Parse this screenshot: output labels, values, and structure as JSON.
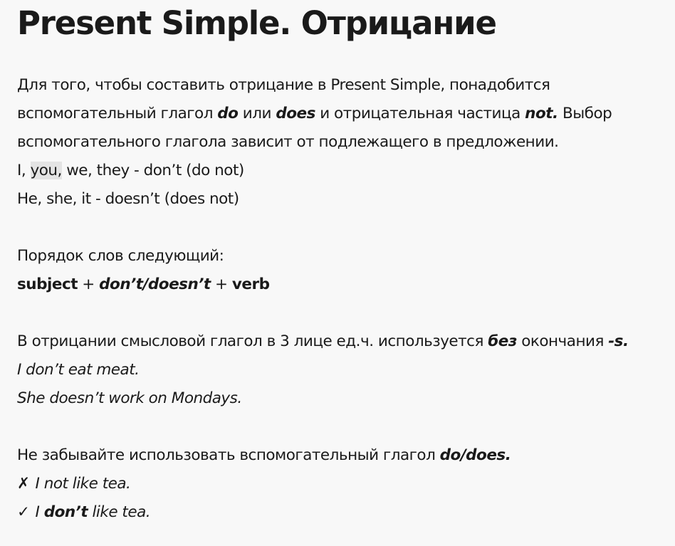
{
  "title": "Present Simple. Отрицание",
  "intro": {
    "l1": "Для того, чтобы составить отрицание в Present Simple, понадобится",
    "l2_a": "вспомогательный глагол ",
    "l2_do": "do",
    "l2_b": " или ",
    "l2_does": "does",
    "l2_c": " и отрицательная частица ",
    "l2_not": "not.",
    "l2_d": " Выбор",
    "l3": "вспомогательного глагола зависит от подлежащего в предложении."
  },
  "pronouns": {
    "p1_a": "I, ",
    "p1_you": "you,",
    "p1_b": " we, they - don’t (do not)",
    "p2": "He, she, it - doesn’t (does not)"
  },
  "order": {
    "heading": "Порядок слов следующий:",
    "subject": "subject",
    "plus1": " + ",
    "aux": "don’t/doesn’t",
    "plus2": " + ",
    "verb": "verb"
  },
  "third_person": {
    "a": "В отрицании смысловой глагол в 3 лице ед.ч. используется ",
    "bez": "без",
    "b": " окончания ",
    "s": "-s.",
    "ex1": "I don’t eat meat.",
    "ex2": "She doesn’t work on Mondays."
  },
  "reminder": {
    "a": "Не забывайте использовать вспомогательный глагол ",
    "dodoes": "do/does.",
    "wrong_mark": "✗",
    "wrong": "I not like tea.",
    "right_mark": "✓",
    "right_a": "I ",
    "right_dont": "don’t",
    "right_b": " like tea."
  }
}
